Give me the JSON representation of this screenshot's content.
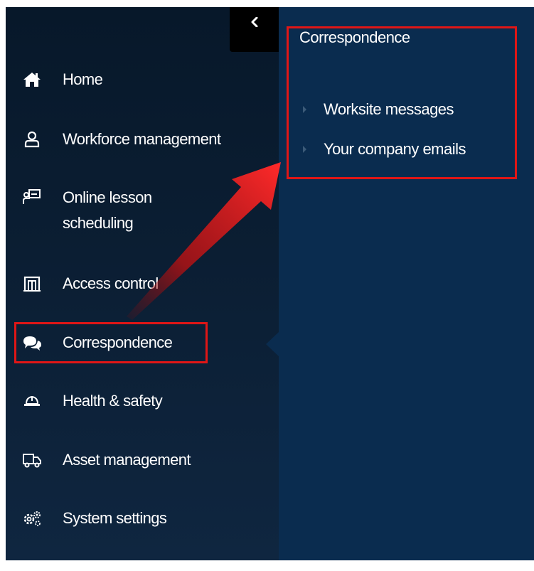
{
  "sidebar": {
    "collapse_icon": "chevron-left-icon",
    "items": [
      {
        "label": "Home",
        "icon": "home-icon"
      },
      {
        "label": "Workforce management",
        "icon": "user-icon"
      },
      {
        "label": "Online lesson scheduling",
        "icon": "teacher-board-icon"
      },
      {
        "label": "Access control",
        "icon": "gate-icon"
      },
      {
        "label": "Correspondence",
        "icon": "chat-bubbles-icon",
        "active": true
      },
      {
        "label": "Health & safety",
        "icon": "hard-hat-icon"
      },
      {
        "label": "Asset management",
        "icon": "truck-icon"
      },
      {
        "label": "System settings",
        "icon": "gears-icon"
      }
    ]
  },
  "submenu": {
    "title": "Correspondence",
    "items": [
      {
        "label": "Worksite messages"
      },
      {
        "label": "Your company emails"
      }
    ]
  },
  "colors": {
    "sidebar_bg": "#0b1e33",
    "submenu_bg": "#0a2c4f",
    "highlight": "#e01616",
    "text": "#ffffff"
  }
}
